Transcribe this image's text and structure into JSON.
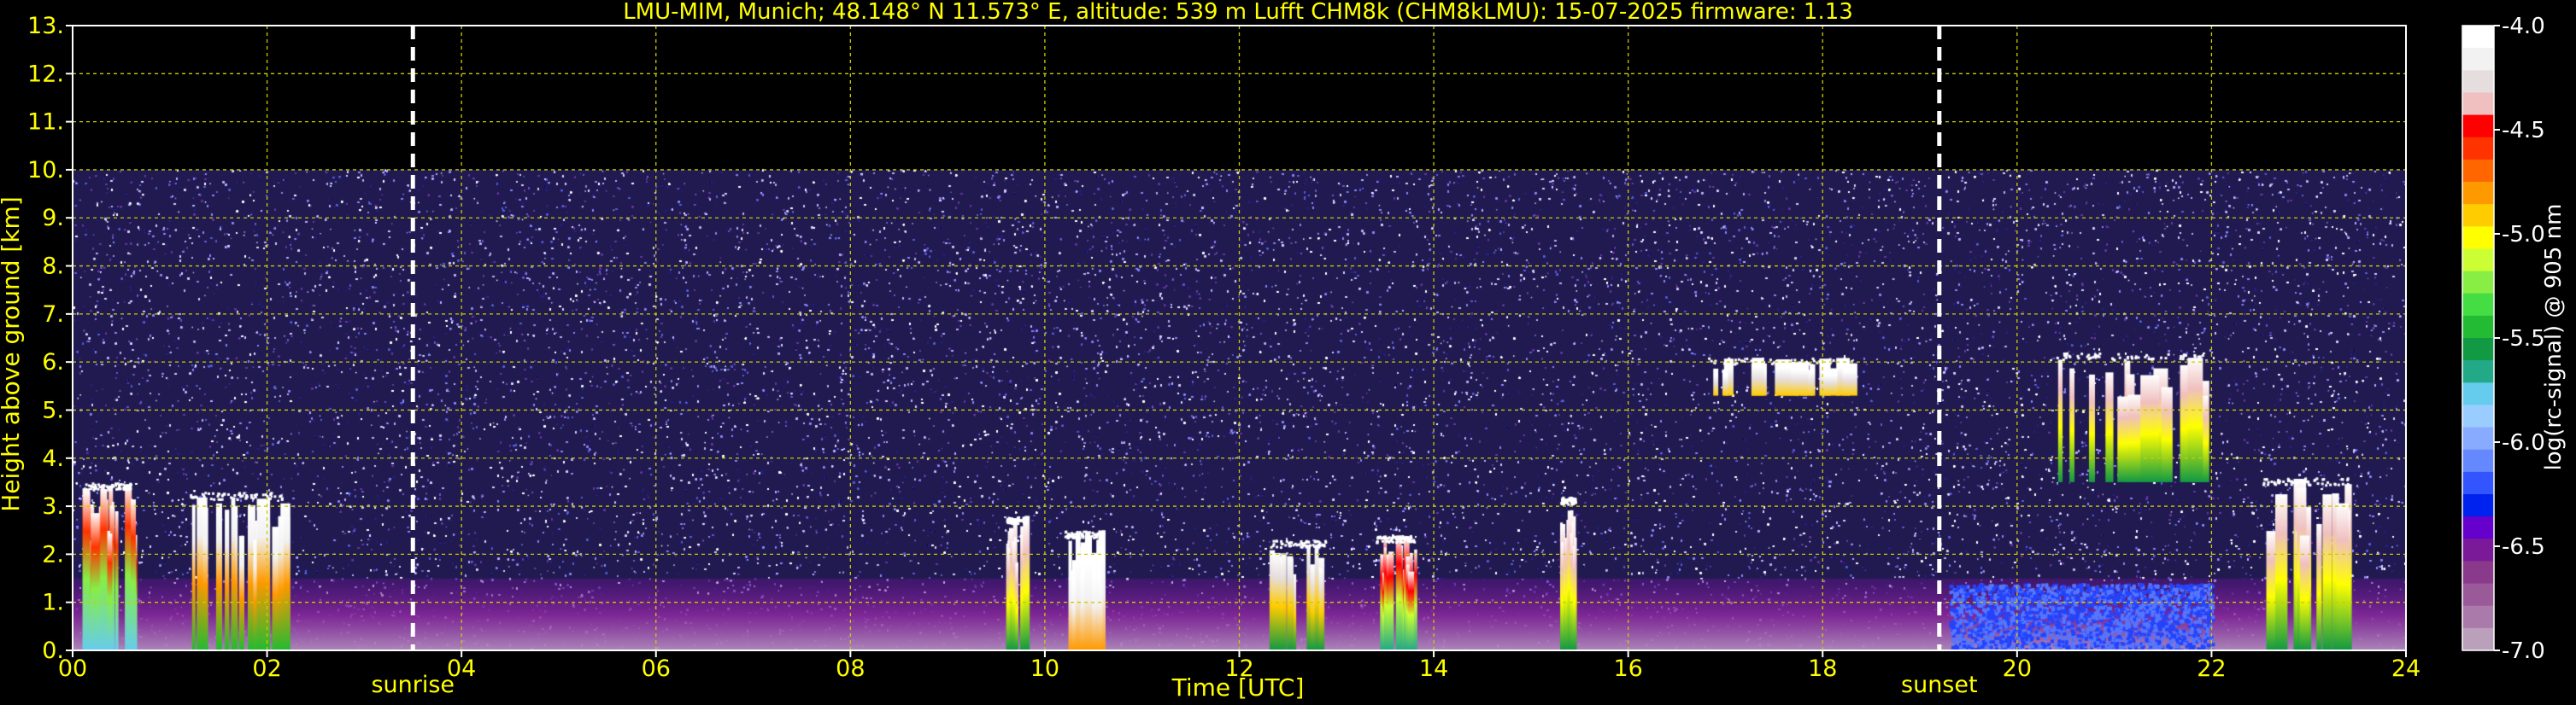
{
  "chart_data": {
    "type": "heatmap",
    "title": "LMU-MIM, Munich; 48.148° N 11.573° E, altitude: 539 m    Lufft CHM8k (CHM8kLMU): 15-07-2025    firmware: 1.13",
    "xlabel": "Time [UTC]",
    "ylabel": "Height above ground [km]",
    "xlim": [
      0,
      24
    ],
    "ylim": [
      0,
      13
    ],
    "x_ticks": [
      0,
      2,
      4,
      6,
      8,
      10,
      12,
      14,
      16,
      18,
      20,
      22,
      24
    ],
    "x_tick_labels": [
      "00",
      "02",
      "04",
      "06",
      "08",
      "10",
      "12",
      "14",
      "16",
      "18",
      "20",
      "22",
      "24"
    ],
    "y_ticks": [
      0,
      1,
      2,
      3,
      4,
      5,
      6,
      7,
      8,
      9,
      10,
      11,
      12,
      13
    ],
    "y_tick_labels": [
      "0.",
      "1.",
      "2.",
      "3.",
      "4.",
      "5.",
      "6.",
      "7.",
      "8.",
      "9.",
      "10.",
      "11.",
      "12.",
      "13."
    ],
    "grid": true,
    "markers": [
      {
        "label": "sunrise",
        "x": 3.5
      },
      {
        "label": "sunset",
        "x": 19.2
      }
    ],
    "colorbar": {
      "label": "log(rc-signal) @ 905 nm",
      "range": [
        -7.0,
        -4.0
      ],
      "tick_values": [
        -4.0,
        -4.5,
        -5.0,
        -5.5,
        -6.0,
        -6.5,
        -7.0
      ],
      "tick_labels": [
        "-4.0",
        "-4.5",
        "-5.0",
        "-5.5",
        "-6.0",
        "-6.5",
        "-7.0"
      ],
      "colors": [
        "#ffffff",
        "#f2f2f2",
        "#e6dede",
        "#f0c0c0",
        "#ff0000",
        "#ff3300",
        "#ff6600",
        "#ff9900",
        "#ffcc00",
        "#ffff00",
        "#ccff33",
        "#88ee44",
        "#44dd44",
        "#22bb33",
        "#119944",
        "#22aa88",
        "#66ccee",
        "#99ccff",
        "#88aaff",
        "#6688ff",
        "#3355ff",
        "#0022ee",
        "#6600cc",
        "#7a1a99",
        "#8a3a8a",
        "#9a5a9a",
        "#aa7aaa",
        "#baa0ba"
      ]
    },
    "signal_features": [
      {
        "name": "noise_layer",
        "x": [
          0,
          24
        ],
        "y": [
          0,
          10
        ],
        "level": -6.5
      },
      {
        "name": "boundary_layer",
        "x": [
          0,
          24
        ],
        "y": [
          0,
          1.5
        ],
        "level": -6.6
      },
      {
        "name": "cloud",
        "x": [
          0.1,
          0.6
        ],
        "y": [
          0,
          3.5
        ],
        "level": -5.2
      },
      {
        "name": "cloud",
        "x": [
          1.2,
          2.2
        ],
        "y": [
          0,
          3.3
        ],
        "level": -4.8
      },
      {
        "name": "cloud",
        "x": [
          9.6,
          9.8
        ],
        "y": [
          0,
          2.8
        ],
        "level": -5.0
      },
      {
        "name": "cloud",
        "x": [
          10.2,
          10.6
        ],
        "y": [
          0,
          2.5
        ],
        "level": -4.2
      },
      {
        "name": "cloud",
        "x": [
          12.3,
          12.9
        ],
        "y": [
          0,
          2.3
        ],
        "level": -4.9
      },
      {
        "name": "cloud",
        "x": [
          13.4,
          13.8
        ],
        "y": [
          0,
          2.4
        ],
        "level": -5.1
      },
      {
        "name": "cloud",
        "x": [
          15.3,
          15.45
        ],
        "y": [
          0,
          3.2
        ],
        "level": -5.0
      },
      {
        "name": "cloud",
        "x": [
          16.8,
          18.3
        ],
        "y": [
          5.3,
          6.1
        ],
        "level": -4.3
      },
      {
        "name": "cloud",
        "x": [
          20.4,
          21.9
        ],
        "y": [
          3.5,
          6.2
        ],
        "level": -5.0
      },
      {
        "name": "cloud",
        "x": [
          22.5,
          23.4
        ],
        "y": [
          0,
          3.6
        ],
        "level": -5.0
      },
      {
        "name": "aerosol",
        "x": [
          19.3,
          22.0
        ],
        "y": [
          0,
          2.0
        ],
        "level": -6.2
      }
    ]
  }
}
